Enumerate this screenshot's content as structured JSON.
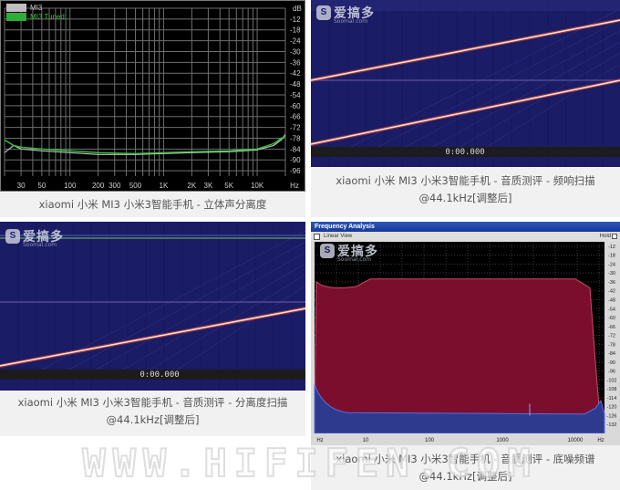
{
  "panel1": {
    "legend": [
      {
        "name": "MI3",
        "color": "#bfbfbf"
      },
      {
        "name": "MI3 Tuned",
        "color": "#33c63a"
      }
    ],
    "y_unit": "dB",
    "y_ticks": [
      "-12",
      "-18",
      "-24",
      "-30",
      "-36",
      "-42",
      "-48",
      "-54",
      "-60",
      "-66",
      "-72",
      "-78",
      "-84",
      "-90",
      "-96"
    ],
    "x_ticks": [
      "30",
      "50",
      "100",
      "200",
      "300",
      "500",
      "1K",
      "2K",
      "3K",
      "5K",
      "10K"
    ],
    "x_unit": "Hz",
    "caption": "xiaomi 小米 MI3 小米3智能手机 - 立体声分离度"
  },
  "panel2": {
    "time": "0:00.000",
    "logo": "爱搞多",
    "logo_sub": "Soomal.com",
    "caption": "xiaomi 小米 MI3 小米3智能手机 - 音质测评 - 频响扫描@44.1kHz[调整后]"
  },
  "panel3": {
    "time": "0:00.000",
    "logo": "爱搞多",
    "logo_sub": "Soomal.com",
    "caption": "xiaomi 小米 MI3 小米3智能手机 - 音质测评 - 分离度扫描@44.1kHz[调整后]"
  },
  "panel4": {
    "title": "Frequency Analysis",
    "toolbar": "Linear View",
    "hold": "Hold",
    "logo": "爱搞多",
    "logo_sub": "Soomal.com",
    "y_ticks": [
      "-12",
      "-18",
      "-24",
      "-30",
      "-36",
      "-42",
      "-48",
      "-54",
      "-60",
      "-66",
      "-72",
      "-78",
      "-84",
      "-90",
      "-96",
      "-102",
      "-108",
      "-114",
      "-120",
      "-126",
      "-132"
    ],
    "x_ticks": [
      "Hz",
      "10",
      "100",
      "1000",
      "10000",
      "Hz"
    ],
    "caption": "xiaomi 小米 MI3 小米3智能手机 - 音质测评 - 底噪频谱@44.1kHz[调整后]"
  },
  "watermark": "WWW.HIFIFEN.COM",
  "colors": {
    "grid": "#6f6f6f",
    "mi3": "#bfbfbf",
    "mi3_tuned": "#33c63a",
    "spectro_bg": "#1b1d6b",
    "sweep": "#f6e3c8",
    "spectrum_red": "#7b0e2d",
    "spectrum_blue": "#2d3a8e"
  }
}
